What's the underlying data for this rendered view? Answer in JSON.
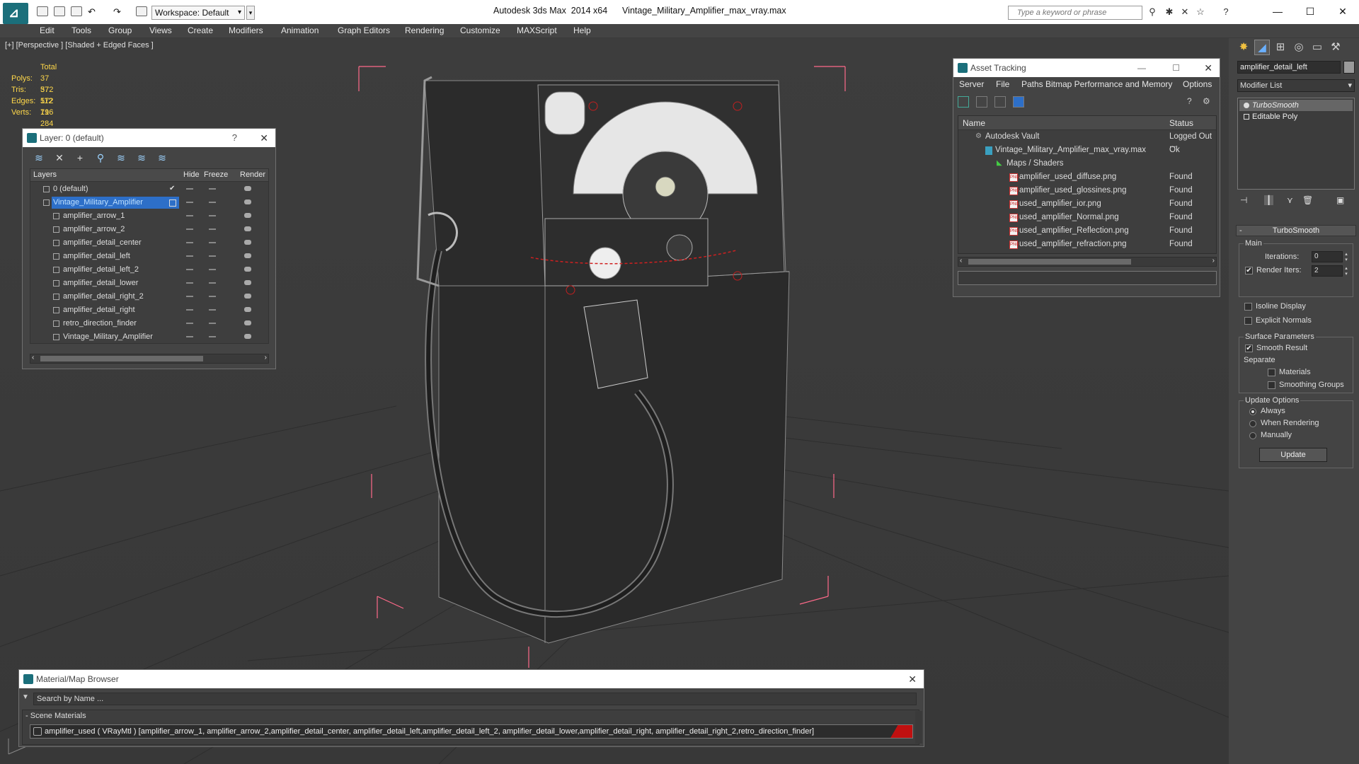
{
  "app": {
    "title": "Autodesk 3ds Max  2014 x64      Vintage_Military_Amplifier_max_vray.max",
    "workspace": "Workspace: Default",
    "search_placeholder": "Type a keyword or phrase"
  },
  "menu": [
    "Edit",
    "Tools",
    "Group",
    "Views",
    "Create",
    "Modifiers",
    "Animation",
    "Graph Editors",
    "Rendering",
    "Customize",
    "MAXScript",
    "Help"
  ],
  "viewport": {
    "label": "[+] [Perspective ] [Shaded + Edged Faces ]",
    "stats": {
      "total_label": "Total",
      "polys_label": "Polys:",
      "polys": "37 572",
      "tris_label": "Tris:",
      "tris": "37 572",
      "edges_label": "Edges:",
      "edges": "112 716",
      "verts_label": "Verts:",
      "verts": "19 284"
    }
  },
  "layer_panel": {
    "title": "Layer: 0 (default)",
    "help": "?",
    "columns": {
      "layers": "Layers",
      "hide": "Hide",
      "freeze": "Freeze",
      "render": "Render"
    },
    "rows": [
      "0 (default)",
      "Vintage_Military_Amplifier",
      "amplifier_arrow_1",
      "amplifier_arrow_2",
      "amplifier_detail_center",
      "amplifier_detail_left",
      "amplifier_detail_left_2",
      "amplifier_detail_lower",
      "amplifier_detail_right_2",
      "amplifier_detail_right",
      "retro_direction_finder",
      "Vintage_Military_Amplifier"
    ]
  },
  "asset_panel": {
    "title": "Asset Tracking",
    "menu": [
      "Server",
      "File",
      "Paths",
      "Bitmap Performance and Memory",
      "Options"
    ],
    "columns": {
      "name": "Name",
      "status": "Status"
    },
    "rows": [
      {
        "name": "Autodesk Vault",
        "status": "Logged Out ..."
      },
      {
        "name": "Vintage_Military_Amplifier_max_vray.max",
        "status": "Ok"
      },
      {
        "name": "Maps / Shaders",
        "status": ""
      },
      {
        "name": "amplifier_used_diffuse.png",
        "status": "Found"
      },
      {
        "name": "amplifier_used_glossines.png",
        "status": "Found"
      },
      {
        "name": "used_amplifier_ior.png",
        "status": "Found"
      },
      {
        "name": "used_amplifier_Normal.png",
        "status": "Found"
      },
      {
        "name": "used_amplifier_Reflection.png",
        "status": "Found"
      },
      {
        "name": "used_amplifier_refraction.png",
        "status": "Found"
      }
    ]
  },
  "material_browser": {
    "title": "Material/Map Browser",
    "search_placeholder": "Search by Name ...",
    "section": "Scene Materials",
    "material": "amplifier_used ( VRayMtl ) [amplifier_arrow_1, amplifier_arrow_2,amplifier_detail_center, amplifier_detail_left,amplifier_detail_left_2, amplifier_detail_lower,amplifier_detail_right, amplifier_detail_right_2,retro_direction_finder]"
  },
  "command_panel": {
    "object_name": "amplifier_detail_left",
    "modifier_list": "Modifier List",
    "stack": [
      "TurboSmooth",
      "Editable Poly"
    ],
    "turbosmooth": {
      "title": "TurboSmooth",
      "main": "Main",
      "iterations_label": "Iterations:",
      "iterations": "0",
      "render_iters_label": "Render Iters:",
      "render_iters": "2",
      "isoline": "Isoline Display",
      "explicit_normals": "Explicit Normals",
      "surface_params": "Surface Parameters",
      "smooth_result": "Smooth Result",
      "separate": "Separate",
      "materials": "Materials",
      "smoothing_groups": "Smoothing Groups",
      "update_options": "Update Options",
      "always": "Always",
      "when_rendering": "When Rendering",
      "manually": "Manually",
      "update": "Update"
    }
  },
  "colors": {
    "selection": "#2d6fc8",
    "stats": "#ffd84a",
    "bbox": "#ff6a8a",
    "material_swatch": "#c01010"
  }
}
